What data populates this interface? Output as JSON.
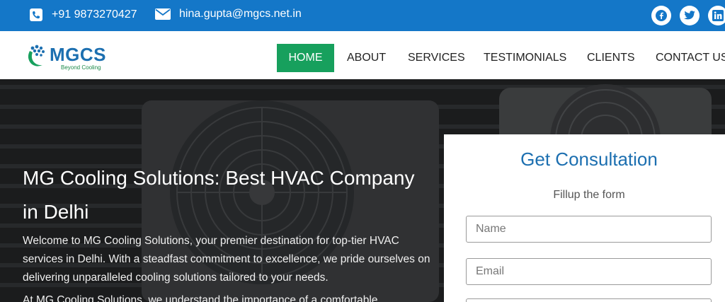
{
  "topbar": {
    "phone": "+91 9873270427",
    "email": "hina.gupta@mgcs.net.in",
    "phone_icon": "phone-icon",
    "email_icon": "envelope-icon",
    "social": [
      "facebook-icon",
      "twitter-icon",
      "linkedin-icon"
    ],
    "color": "#1477c8"
  },
  "logo": {
    "name": "MGCS",
    "tagline": "Beyond Cooling"
  },
  "nav": {
    "home": "HOME",
    "about": "ABOUT",
    "services": "SERVICES",
    "testimonials": "TESTIMONIALS",
    "clients": "CLIENTS",
    "contact": "CONTACT US",
    "active_color": "#17a05d"
  },
  "hero": {
    "title": "MG Cooling Solutions: Best HVAC Company in Delhi",
    "paragraph1": "Welcome to MG Cooling Solutions, your premier destination for top-tier HVAC services in Delhi. With a steadfast commitment to excellence, we pride ourselves on delivering unparalleled cooling solutions tailored to your needs.",
    "paragraph2": "At MG Cooling Solutions, we understand the importance of a comfortable"
  },
  "form": {
    "title": "Get Consultation",
    "subtitle": "Fillup the form",
    "name_placeholder": "Name",
    "email_placeholder": "Email",
    "title_color": "#1c6fb0"
  }
}
